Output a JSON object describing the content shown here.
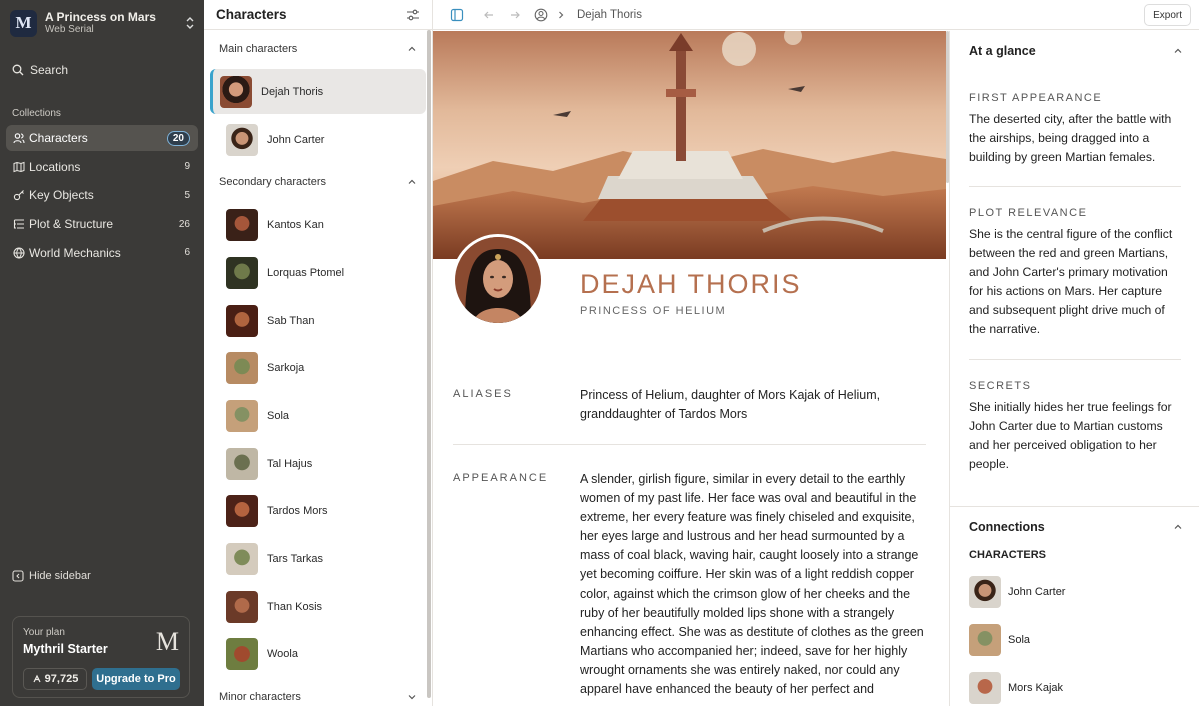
{
  "project": {
    "logo_letter": "M",
    "title": "A Princess on Mars",
    "subtitle": "Web Serial"
  },
  "sidebar": {
    "search_label": "Search",
    "collections_label": "Collections",
    "items": [
      {
        "label": "Characters",
        "count": "20",
        "icon": "users-icon",
        "active": true
      },
      {
        "label": "Locations",
        "count": "9",
        "icon": "map-icon"
      },
      {
        "label": "Key Objects",
        "count": "5",
        "icon": "key-icon"
      },
      {
        "label": "Plot & Structure",
        "count": "26",
        "icon": "list-tree-icon"
      },
      {
        "label": "World Mechanics",
        "count": "6",
        "icon": "globe-icon"
      }
    ],
    "hide_label": "Hide sidebar",
    "plan": {
      "label": "Your plan",
      "name": "Mythril Starter",
      "logo": "M",
      "credits": "97,725",
      "upgrade_label": "Upgrade to Pro"
    }
  },
  "list": {
    "title": "Characters",
    "groups": [
      {
        "label": "Main characters",
        "items": [
          "Dejah Thoris",
          "John Carter"
        ]
      },
      {
        "label": "Secondary characters",
        "items": [
          "Kantos Kan",
          "Lorquas Ptomel",
          "Sab Than",
          "Sarkoja",
          "Sola",
          "Tal Hajus",
          "Tardos Mors",
          "Tars Tarkas",
          "Than Kosis",
          "Woola"
        ]
      },
      {
        "label": "Minor characters",
        "items": []
      }
    ]
  },
  "topbar": {
    "breadcrumb": "Dejah Thoris",
    "export_label": "Export"
  },
  "character": {
    "name": "DEJAH THORIS",
    "title": "PRINCESS OF HELIUM",
    "aliases_label": "ALIASES",
    "aliases": "Princess of Helium, daughter of Mors Kajak of Helium, granddaughter of Tardos Mors",
    "appearance_label": "APPEARANCE",
    "appearance": "A slender, girlish figure, similar in every detail to the earthly women of my past life. Her face was oval and beautiful in the extreme, her every feature was finely chiseled and exquisite, her eyes large and lustrous and her head surmounted by a mass of coal black, waving hair, caught loosely into a strange yet becoming coiffure. Her skin was of a light reddish copper color, against which the crimson glow of her cheeks and the ruby of her beautifully molded lips shone with a strangely enhancing effect. She was as destitute of clothes as the green Martians who accompanied her; indeed, save for her highly wrought ornaments she was entirely naked, nor could any apparel have enhanced the beauty of her perfect and"
  },
  "glance": {
    "title": "At a glance",
    "first_appearance_label": "FIRST APPEARANCE",
    "first_appearance": "The deserted city, after the battle with the airships, being dragged into a building by green Martian females.",
    "plot_label": "PLOT RELEVANCE",
    "plot": "She is the central figure of the conflict between the red and green Martians, and John Carter's primary motivation for his actions on Mars. Her capture and subsequent plight drive much of the narrative.",
    "secrets_label": "SECRETS",
    "secrets": "She initially hides her true feelings for John Carter due to Martian customs and her perceived obligation to her people."
  },
  "connections": {
    "title": "Connections",
    "subtitle": "CHARACTERS",
    "items": [
      "John Carter",
      "Sola",
      "Mors Kajak"
    ]
  }
}
